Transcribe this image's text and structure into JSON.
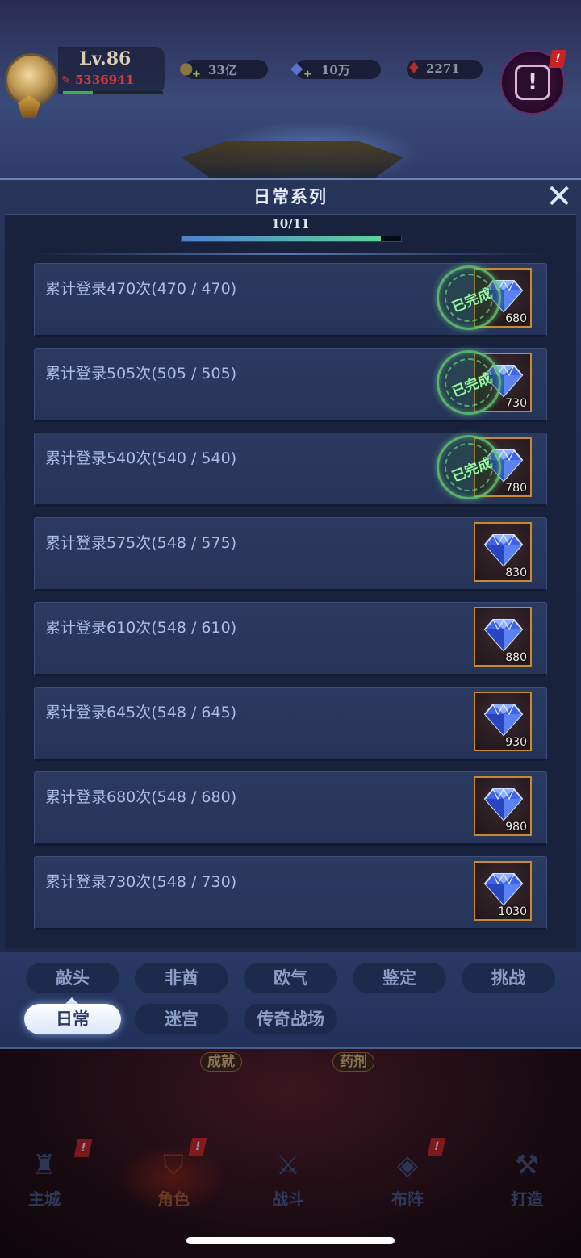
{
  "hud": {
    "level": "Lv.86",
    "power": "5336941",
    "exp_fraction": 0.3,
    "resources": [
      {
        "icon": "gold-coin-icon",
        "value": "33亿"
      },
      {
        "icon": "diamond-icon",
        "value": "10万"
      },
      {
        "icon": "red-crystal-icon",
        "value": "2271"
      }
    ]
  },
  "dialog": {
    "title": "日常系列",
    "close_label": "✕",
    "progress_text": "10/11",
    "progress_fraction": 0.909
  },
  "tasks": [
    {
      "label": "累计登录470次(470 / 470)",
      "reward": "680",
      "completed": true
    },
    {
      "label": "累计登录505次(505 / 505)",
      "reward": "730",
      "completed": true
    },
    {
      "label": "累计登录540次(540 / 540)",
      "reward": "780",
      "completed": true
    },
    {
      "label": "累计登录575次(548 / 575)",
      "reward": "830",
      "completed": false
    },
    {
      "label": "累计登录610次(548 / 610)",
      "reward": "880",
      "completed": false
    },
    {
      "label": "累计登录645次(548 / 645)",
      "reward": "930",
      "completed": false
    },
    {
      "label": "累计登录680次(548 / 680)",
      "reward": "980",
      "completed": false
    },
    {
      "label": "累计登录730次(548 / 730)",
      "reward": "1030",
      "completed": false
    }
  ],
  "completed_stamp": "已完成",
  "tabs": {
    "row1": [
      "敲头",
      "非酋",
      "欧气",
      "鉴定",
      "挑战"
    ],
    "row2": [
      "日常",
      "迷宫",
      "传奇战场"
    ],
    "active": "日常"
  },
  "sub_labels": [
    "成就",
    "药剂"
  ],
  "bottom_nav": [
    {
      "label": "主城",
      "icon": "castle-icon",
      "badge": "!"
    },
    {
      "label": "角色",
      "icon": "helmet-icon",
      "badge": "!",
      "active": true
    },
    {
      "label": "战斗",
      "icon": "crossed-swords-icon"
    },
    {
      "label": "布阵",
      "icon": "formation-icon",
      "badge": "!"
    },
    {
      "label": "打造",
      "icon": "anvil-icon"
    }
  ],
  "colors": {
    "panel": "#27355a",
    "reward_border": "#c88a2e",
    "stamp_green": "#68d678",
    "power_red": "#d63a3a"
  }
}
